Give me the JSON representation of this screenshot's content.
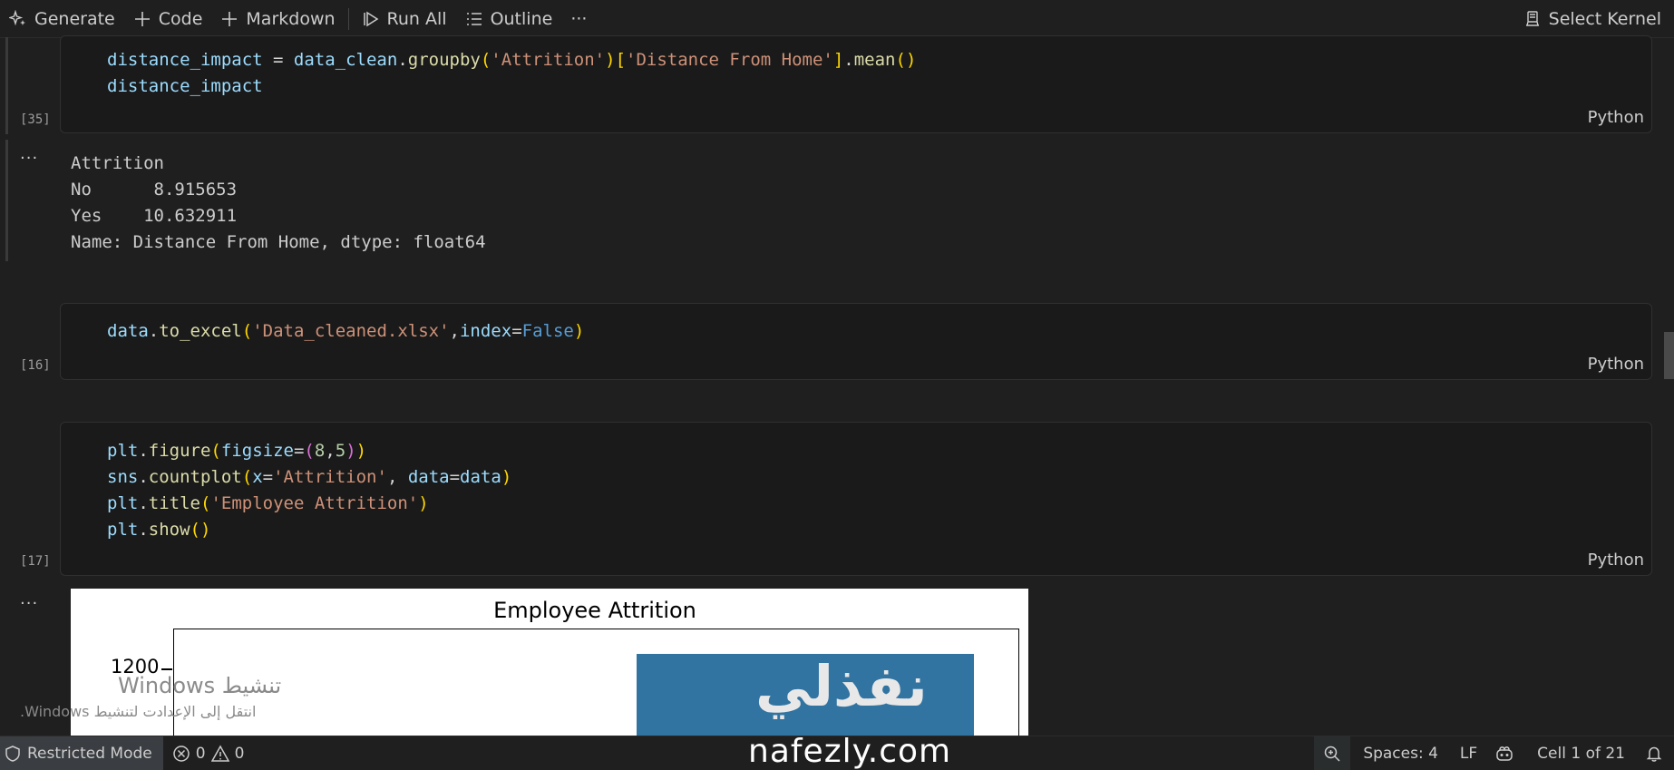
{
  "toolbar": {
    "generate": "Generate",
    "code": "Code",
    "markdown": "Markdown",
    "run_all": "Run All",
    "outline": "Outline",
    "more": "···",
    "select_kernel": "Select Kernel"
  },
  "cells": [
    {
      "exec_count": "[35]",
      "language": "Python",
      "lines": [
        [
          [
            "v",
            "distance_impact"
          ],
          [
            "",
            ""
          ],
          [
            "",
            " = "
          ],
          [
            "v",
            "data_clean"
          ],
          [
            "",
            "."
          ],
          [
            "f",
            "groupby"
          ],
          [
            "p1",
            "("
          ],
          [
            "s",
            "'Attrition'"
          ],
          [
            "p1",
            ")"
          ],
          [
            "p1",
            "["
          ],
          [
            "s",
            "'Distance From Home'"
          ],
          [
            "p1",
            "]"
          ],
          [
            "",
            "."
          ],
          [
            "f",
            "mean"
          ],
          [
            "p1",
            "()"
          ]
        ],
        [
          [
            "v",
            "distance_impact"
          ]
        ]
      ]
    },
    {
      "exec_count": "[16]",
      "language": "Python",
      "lines": [
        [
          [
            "v",
            "data"
          ],
          [
            "",
            "."
          ],
          [
            "f",
            "to_excel"
          ],
          [
            "p1",
            "("
          ],
          [
            "s",
            "'Data_cleaned.xlsx'"
          ],
          [
            "",
            ","
          ],
          [
            "v",
            "index"
          ],
          [
            "",
            "="
          ],
          [
            "k",
            "False"
          ],
          [
            "p1",
            ")"
          ]
        ]
      ]
    },
    {
      "exec_count": "[17]",
      "language": "Python",
      "lines": [
        [
          [
            "v",
            "plt"
          ],
          [
            "",
            "."
          ],
          [
            "f",
            "figure"
          ],
          [
            "p1",
            "("
          ],
          [
            "v",
            "figsize"
          ],
          [
            "",
            "="
          ],
          [
            "p2",
            "("
          ],
          [
            "n",
            "8"
          ],
          [
            "",
            ","
          ],
          [
            "n",
            "5"
          ],
          [
            "p2",
            ")"
          ],
          [
            "p1",
            ")"
          ]
        ],
        [
          [
            "v",
            "sns"
          ],
          [
            "",
            "."
          ],
          [
            "f",
            "countplot"
          ],
          [
            "p1",
            "("
          ],
          [
            "v",
            "x"
          ],
          [
            "",
            "="
          ],
          [
            "s",
            "'Attrition'"
          ],
          [
            "",
            ", "
          ],
          [
            "v",
            "data"
          ],
          [
            "",
            "="
          ],
          [
            "v",
            "data"
          ],
          [
            "p1",
            ")"
          ]
        ],
        [
          [
            "v",
            "plt"
          ],
          [
            "",
            "."
          ],
          [
            "f",
            "title"
          ],
          [
            "p1",
            "("
          ],
          [
            "s",
            "'Employee Attrition'"
          ],
          [
            "p1",
            ")"
          ]
        ],
        [
          [
            "v",
            "plt"
          ],
          [
            "",
            "."
          ],
          [
            "f",
            "show"
          ],
          [
            "p1",
            "()"
          ]
        ]
      ]
    }
  ],
  "output1": {
    "ellipsis": "···",
    "lines": [
      "Attrition",
      "No      8.915653",
      "Yes    10.632911",
      "Name: Distance From Home, dtype: float64"
    ]
  },
  "output2": {
    "ellipsis": "···"
  },
  "chart_data": {
    "type": "bar",
    "title": "Employee Attrition",
    "xlabel": "",
    "ylabel": "",
    "yticks": [
      1200
    ],
    "note": ""
  },
  "overlay": {
    "watermark_ar": "نفذلي",
    "site": "nafezly.com",
    "win_activate_title": "تنشيط Windows",
    "win_activate_sub": "انتقل إلى الإعدادت لتنشيط Windows."
  },
  "status": {
    "restricted": "Restricted Mode",
    "errors": "0",
    "warnings": "0",
    "spaces": "Spaces: 4",
    "eol": "LF",
    "cell": "Cell 1 of 21"
  },
  "colors": {
    "background": "#1f1f1f",
    "bar": "#3274a1",
    "string": "#ce9178",
    "function": "#dcdcaa",
    "variable": "#9cdcfe",
    "keyword": "#569cd6"
  }
}
